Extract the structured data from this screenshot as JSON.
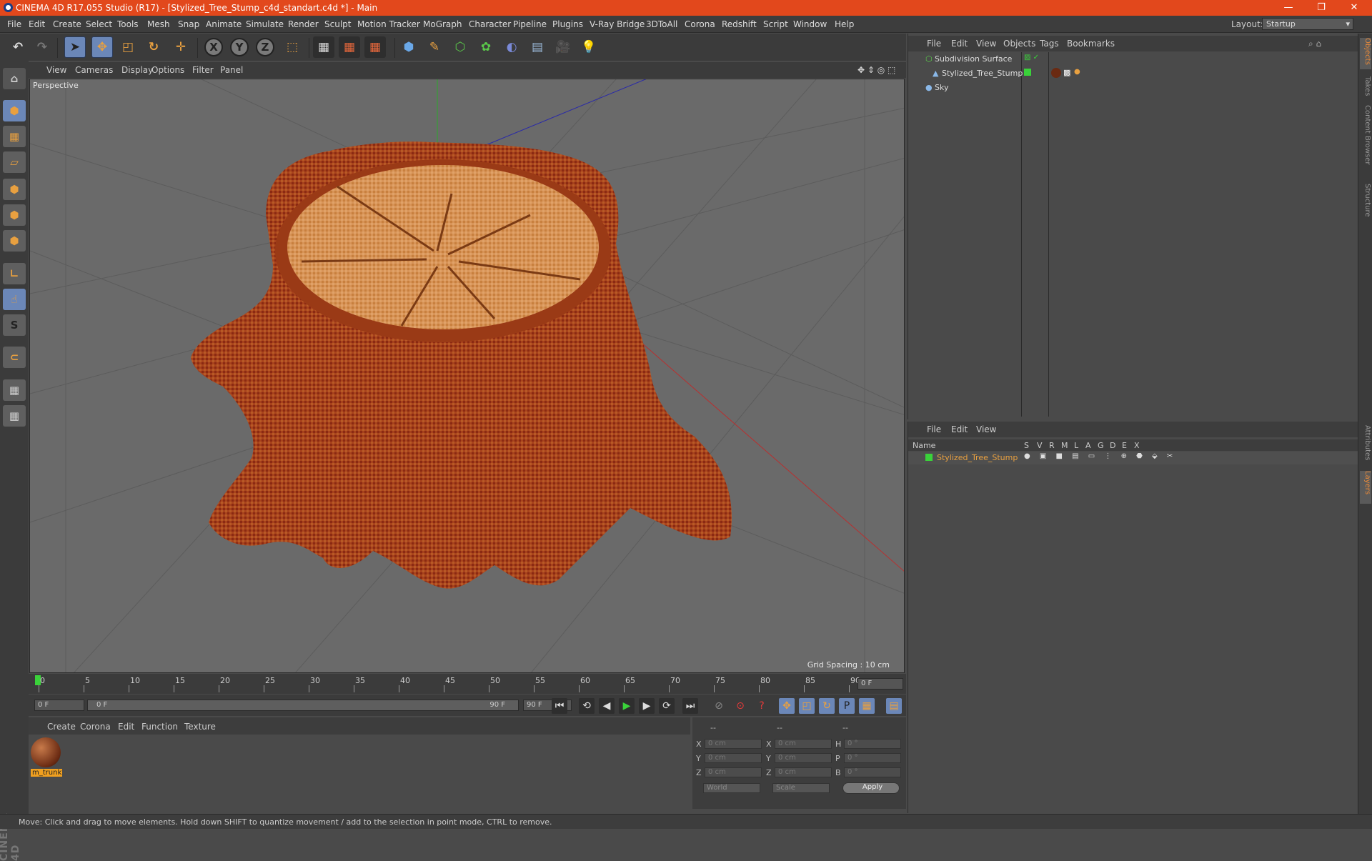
{
  "app": {
    "title": "CINEMA 4D R17.055 Studio (R17) - [Stylized_Tree_Stump_c4d_standart.c4d *] - Main",
    "window_buttons": [
      "—",
      "❐",
      "✕"
    ]
  },
  "menu": {
    "items": [
      "File",
      "Edit",
      "Create",
      "Select",
      "Tools",
      "Mesh",
      "Snap",
      "Animate",
      "Simulate",
      "Render",
      "Sculpt",
      "Motion Tracker",
      "MoGraph",
      "Character",
      "Pipeline",
      "Plugins",
      "V-Ray Bridge",
      "3DToAll",
      "Corona",
      "Redshift",
      "Script",
      "Window",
      "Help"
    ],
    "layout_label": "Layout:",
    "layout_value": "Startup"
  },
  "viewport": {
    "menu": [
      "View",
      "Cameras",
      "Display",
      "Options",
      "Filter",
      "Panel"
    ],
    "label": "Perspective",
    "grid_spacing": "Grid Spacing : 10 cm"
  },
  "timeline": {
    "ticks": [
      "0",
      "5",
      "10",
      "15",
      "20",
      "25",
      "30",
      "35",
      "40",
      "45",
      "50",
      "55",
      "60",
      "65",
      "70",
      "75",
      "80",
      "85",
      "90"
    ],
    "frame_end_display": "0 F",
    "start_field": "0 F",
    "slider_start": "0 F",
    "slider_end": "90 F",
    "end_field": "90 F"
  },
  "material_panel": {
    "menu": [
      "Create",
      "Corona",
      "Edit",
      "Function",
      "Texture"
    ],
    "material_name": "m_trunk"
  },
  "coord_panel": {
    "headers": [
      "--",
      "--",
      "--"
    ],
    "rows": [
      {
        "a": "X",
        "av": "0 cm",
        "b": "X",
        "bv": "0 cm",
        "c": "H",
        "cv": "0 °"
      },
      {
        "a": "Y",
        "av": "0 cm",
        "b": "Y",
        "bv": "0 cm",
        "c": "P",
        "cv": "0 °"
      },
      {
        "a": "Z",
        "av": "0 cm",
        "b": "Z",
        "bv": "0 cm",
        "c": "B",
        "cv": "0 °"
      }
    ],
    "world": "World",
    "scale": "Scale",
    "apply": "Apply"
  },
  "object_manager": {
    "menu": [
      "File",
      "Edit",
      "View",
      "Objects",
      "Tags",
      "Bookmarks"
    ],
    "objects": [
      "Subdivision Surface",
      "Stylized_Tree_Stump",
      "Sky"
    ]
  },
  "layer_manager": {
    "menu": [
      "File",
      "Edit",
      "View"
    ],
    "col_name": "Name",
    "cols": [
      "S",
      "V",
      "R",
      "M",
      "L",
      "A",
      "G",
      "D",
      "E",
      "X"
    ],
    "layer_name": "Stylized_Tree_Stump"
  },
  "right_tabs": [
    "Objects",
    "Takes",
    "Content Browser",
    "Structure",
    "Attributes",
    "Layers"
  ],
  "status": "Move: Click and drag to move elements. Hold down SHIFT to quantize movement / add to the selection in point mode, CTRL to remove.",
  "colors": {
    "title_bar": "#e2481c",
    "accent": "#e88a3a",
    "stump": "#a8421c"
  }
}
